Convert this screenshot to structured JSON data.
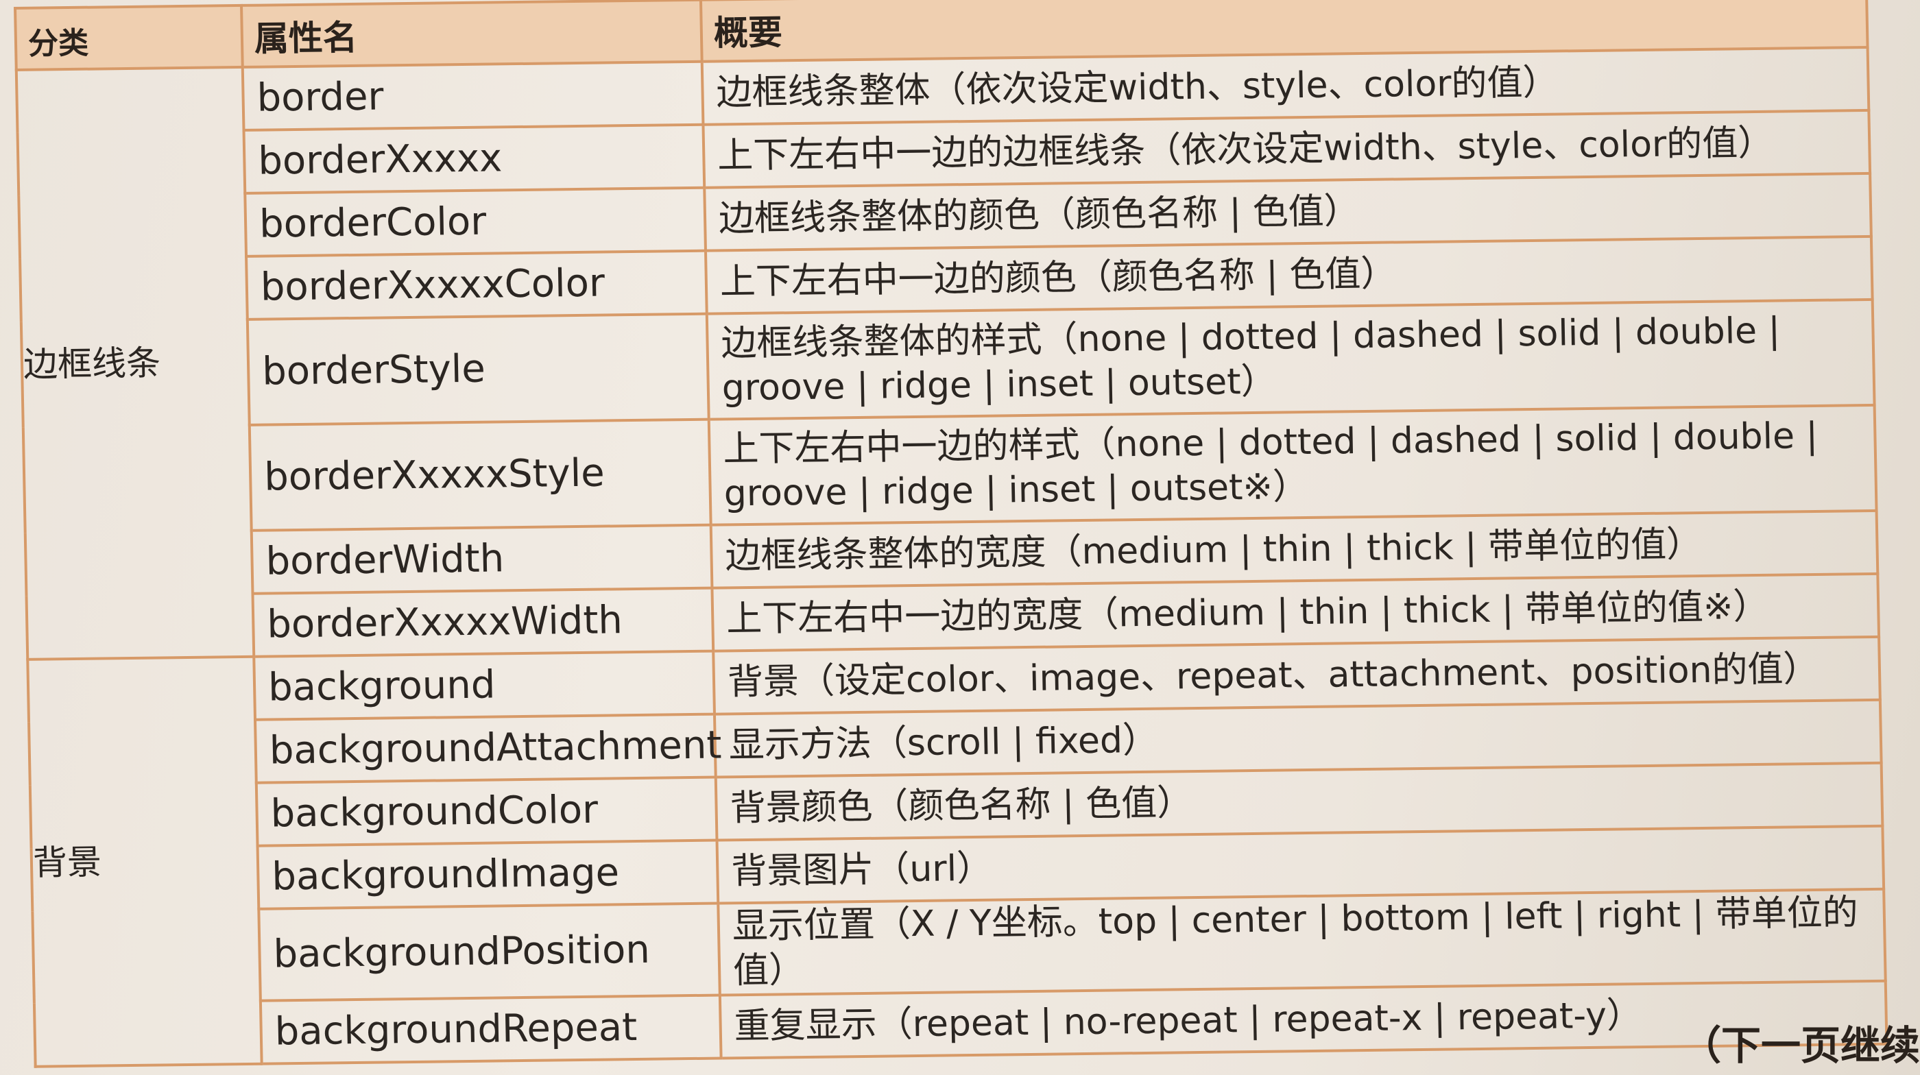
{
  "table": {
    "headers": {
      "category": "分类",
      "property": "属性名",
      "summary": "概要"
    },
    "groups": [
      {
        "category": "边框线条",
        "rows": [
          {
            "property": "border",
            "summary": "边框线条整体（依次设定width、style、color的值）"
          },
          {
            "property": "borderXxxxx",
            "summary": "上下左右中一边的边框线条（依次设定width、style、color的值）"
          },
          {
            "property": "borderColor",
            "summary": "边框线条整体的颜色（颜色名称 | 色值）"
          },
          {
            "property": "borderXxxxxColor",
            "summary": "上下左右中一边的颜色（颜色名称 | 色值）"
          },
          {
            "property": "borderStyle",
            "summary": "边框线条整体的样式（none | dotted | dashed | solid | double | groove | ridge | inset | outset）"
          },
          {
            "property": "borderXxxxxStyle",
            "summary": "上下左右中一边的样式（none | dotted | dashed | solid | double | groove | ridge | inset | outset※）"
          },
          {
            "property": "borderWidth",
            "summary": "边框线条整体的宽度（medium | thin | thick | 带单位的值）"
          },
          {
            "property": "borderXxxxxWidth",
            "summary": "上下左右中一边的宽度（medium | thin | thick | 带单位的值※）"
          }
        ]
      },
      {
        "category": "背景",
        "rows": [
          {
            "property": "background",
            "summary": "背景（设定color、image、repeat、attachment、position的值）"
          },
          {
            "property": "backgroundAttachment",
            "summary": "显示方法（scroll | fixed）"
          },
          {
            "property": "backgroundColor",
            "summary": "背景颜色（颜色名称 | 色值）"
          },
          {
            "property": "backgroundImage",
            "summary": "背景图片（url）"
          },
          {
            "property": "backgroundPosition",
            "summary": "显示位置（X / Y坐标。top | center | bottom | left | right | 带单位的值）"
          },
          {
            "property": "backgroundRepeat",
            "summary": "重复显示（repeat | no-repeat | repeat-x | repeat-y）"
          }
        ]
      }
    ]
  },
  "footer": {
    "continue_note": "（下一页继续"
  },
  "colors": {
    "border": "#d79a68",
    "header_background": "#efcfb0",
    "paper": "#efe8df"
  }
}
